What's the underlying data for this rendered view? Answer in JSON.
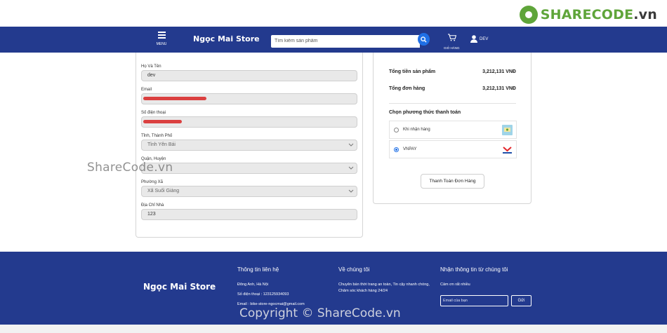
{
  "watermark": {
    "logo_main": "SHARECODE",
    "logo_suffix": ".vn",
    "center_text": "ShareCode.vn",
    "copyright_text": "Copyright © ShareCode.vn"
  },
  "header": {
    "menu_label": "MENU",
    "brand": "Ngọc Mai Store",
    "search_placeholder": "Tìm kiếm sản phẩm",
    "cart_label": "GIỎ HÀNG",
    "user_label": "DEV"
  },
  "form": {
    "fullname": {
      "label": "Họ Và Tên",
      "value": "dev"
    },
    "email": {
      "label": "Email",
      "value": ""
    },
    "phone": {
      "label": "Số điện thoại",
      "value": ""
    },
    "province": {
      "label": "Tỉnh, Thành Phố",
      "value": "Tỉnh Yên Bái"
    },
    "district": {
      "label": "Quận, Huyện",
      "value": ""
    },
    "ward": {
      "label": "Phường Xã",
      "value": "Xã Suối Giàng"
    },
    "address": {
      "label": "Địa Chỉ Nhà",
      "value": "123"
    }
  },
  "summary": {
    "subtotal_label": "Tổng tiền sản phẩm",
    "subtotal_value": "3,212,131 VNĐ",
    "total_label": "Tổng đơn hàng",
    "total_value": "3,212,131 VNĐ",
    "payment_title": "Chọn phương thức thanh toán",
    "payment_options": [
      {
        "label": "Khi nhận hàng",
        "selected": false,
        "icon": "cash-on-delivery-icon"
      },
      {
        "label": "VNPAY",
        "selected": true,
        "icon": "vnpay-logo-icon"
      }
    ],
    "checkout_button": "Thanh Toán Đơn Hàng"
  },
  "footer": {
    "brand": "Ngọc Mai Store",
    "contact": {
      "title": "Thông tin liên hệ",
      "address": "Đông Anh, Hà Nội",
      "phone": "Số điện thoại : 123125934093",
      "email": "Email : bike-store-ngocmai@gmail.com"
    },
    "about": {
      "title": "Về chúng tôi",
      "text": "Chuyên bán thời trang an toàn, Tin cậy nhanh chóng, Chăm sóc khách hàng 24/24"
    },
    "newsletter": {
      "title": "Nhận thông tin từ chúng tôi",
      "text": "Cảm ơn rất nhiều",
      "placeholder": "Email của bạn",
      "button": "Gửi"
    }
  },
  "colors": {
    "primary": "#233a8e",
    "search_button": "#1f6fe6",
    "scribble": "#d92d2d"
  }
}
